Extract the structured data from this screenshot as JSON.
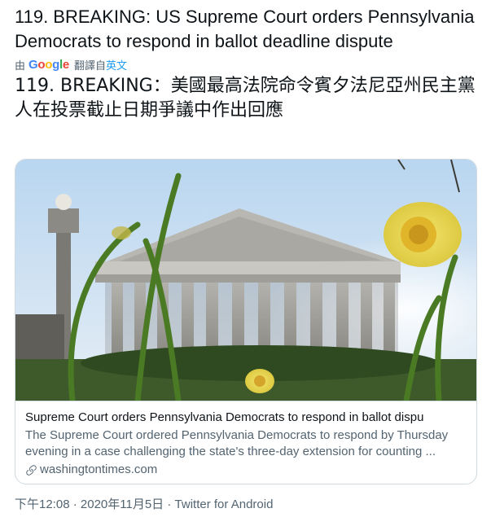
{
  "tweet": {
    "text": "119. BREAKING: US Supreme Court orders Pennsylvania Democrats to respond in ballot deadline dispute",
    "translate": {
      "prefix": "由",
      "provider": "Google",
      "from_label": "翻譯自",
      "lang": "英文"
    },
    "translated_text": "119. BREAKING：美國最高法院命令賓夕法尼亞州民主黨人在投票截止日期爭議中作出回應",
    "card": {
      "title": "Supreme Court orders Pennsylvania Democrats to respond in ballot dispu",
      "description": "The Supreme Court ordered Pennsylvania Democrats to respond by Thursday evening in a case challenging the state's three-day extension for counting ...",
      "domain": "washingtontimes.com",
      "image_icon": "supreme-court-photo"
    },
    "meta": {
      "time": "下午12:08",
      "date": "2020年11月5日",
      "separator": "·",
      "source": "Twitter for Android"
    }
  },
  "colors": {
    "text": "#0f1419",
    "secondary": "#536471",
    "link": "#1d9bf0",
    "border": "#cfd9de"
  }
}
